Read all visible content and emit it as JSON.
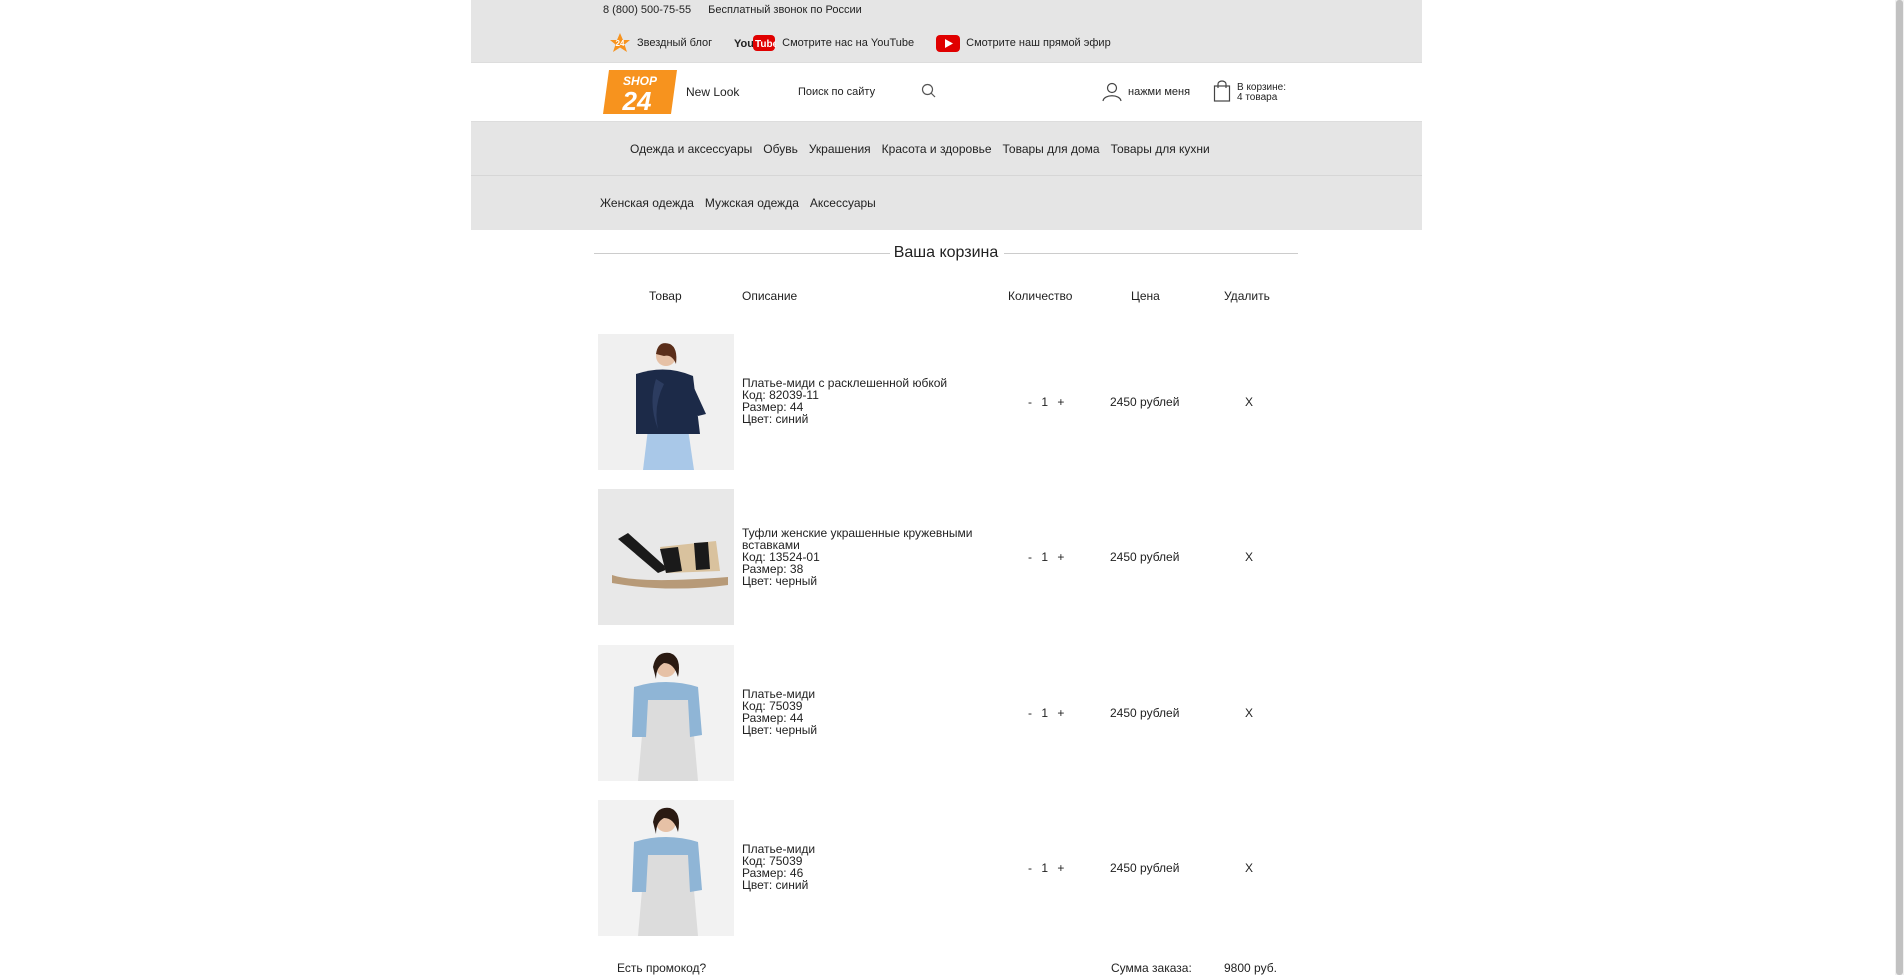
{
  "topbar": {
    "phone": "8 (800) 500-75-55",
    "free_call": "Бесплатный звонок по России",
    "links": [
      "Звездный блог",
      "Смотрите нас на YouTube",
      "Смотрите наш прямой эфир"
    ]
  },
  "header": {
    "logo_top": "SHOP",
    "logo_bottom": "24",
    "brand": "New Look",
    "search_placeholder": "Поиск по сайту",
    "user_label": "нажми меня",
    "cart_line1": "В корзине:",
    "cart_line2": "4 товара"
  },
  "nav_main": [
    "Одежда и аксессуары",
    "Обувь",
    "Украшения",
    "Красота и здоровье",
    "Товары для дома",
    "Товары для кухни"
  ],
  "nav_sub": [
    "Женская одежда",
    "Мужская одежда",
    "Аксессуары"
  ],
  "cart": {
    "title": "Ваша корзина",
    "columns": {
      "product": "Товар",
      "description": "Описание",
      "quantity": "Количество",
      "price": "Цена",
      "remove": "Удалить"
    },
    "items": [
      {
        "name": "Платье-миди с расклешенной юбкой",
        "code": "Код: 82039-11",
        "size": "Размер: 44",
        "color": "Цвет: синий",
        "minus": "-",
        "qty": "1",
        "plus": "+",
        "price": "2450 рублей",
        "remove": "X"
      },
      {
        "name": "Туфли женские украшенные кружевными вставками",
        "code": "Код: 13524-01",
        "size": "Размер: 38",
        "color": "Цвет: черный",
        "minus": "-",
        "qty": "1",
        "plus": "+",
        "price": "2450 рублей",
        "remove": "X"
      },
      {
        "name": "Платье-миди",
        "code": "Код: 75039",
        "size": "Размер: 44",
        "color": "Цвет: черный",
        "minus": "-",
        "qty": "1",
        "plus": "+",
        "price": "2450 рублей",
        "remove": "X"
      },
      {
        "name": "Платье-миди",
        "code": "Код: 75039",
        "size": "Размер: 46",
        "color": "Цвет: синий",
        "minus": "-",
        "qty": "1",
        "plus": "+",
        "price": "2450 рублей",
        "remove": "X"
      }
    ],
    "promo": "Есть промокод?",
    "total_label": "Сумма заказа:",
    "total_value": "9800 руб."
  },
  "colors": {
    "accent": "#f7931e",
    "youtube": "#e00000",
    "panel": "#e5e5e5"
  }
}
